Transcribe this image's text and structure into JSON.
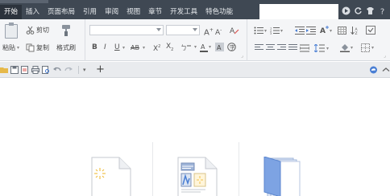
{
  "menu": {
    "items": [
      {
        "label": "开始",
        "active": true
      },
      {
        "label": "插入",
        "active": false
      },
      {
        "label": "页面布局",
        "active": false
      },
      {
        "label": "引用",
        "active": false
      },
      {
        "label": "审阅",
        "active": false
      },
      {
        "label": "视图",
        "active": false
      },
      {
        "label": "章节",
        "active": false
      },
      {
        "label": "开发工具",
        "active": false
      },
      {
        "label": "特色功能",
        "active": false
      }
    ]
  },
  "clipboard": {
    "paste_label": "粘贴",
    "cut_label": "剪切",
    "copy_label": "复制",
    "format_painter_label": "格式刷"
  },
  "font": {
    "name_value": "",
    "size_value": ""
  },
  "colors": {
    "topbar": "#3f4853",
    "ribbon": "#f4f5f7",
    "accent_blue": "#4a7fd4",
    "doc_blue": "#7da3e3"
  }
}
